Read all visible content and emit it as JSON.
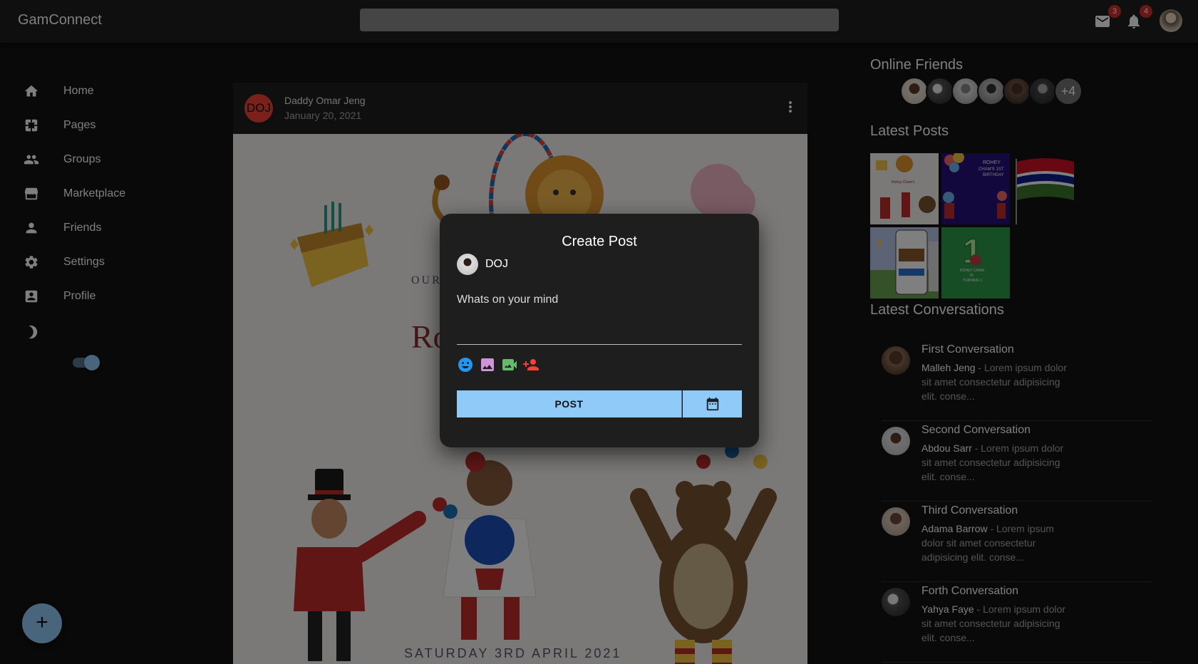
{
  "app": {
    "title": "GamConnect",
    "search_placeholder": ""
  },
  "topbar": {
    "mail_icon": "mail-icon",
    "mail_badge": "3",
    "bell_icon": "notifications-icon",
    "bell_badge": "4"
  },
  "sidebar": {
    "items": [
      {
        "label": "Home",
        "icon": "home-icon"
      },
      {
        "label": "Pages",
        "icon": "pages-icon"
      },
      {
        "label": "Groups",
        "icon": "groups-icon"
      },
      {
        "label": "Marketplace",
        "icon": "storefront-icon"
      },
      {
        "label": "Friends",
        "icon": "person-icon"
      },
      {
        "label": "Settings",
        "icon": "gear-icon"
      },
      {
        "label": "Profile",
        "icon": "account-box-icon"
      }
    ],
    "dark_mode_icon": "moon-icon",
    "dark_mode_on": true,
    "fab_label": "+"
  },
  "post": {
    "avatar_text": "DOJ",
    "author": "Daddy Omar Jeng",
    "date": "January 20, 2021",
    "image_text_top": "OUR",
    "image_text_name": "Ro",
    "image_text_bottom": "SATURDAY 3RD APRIL 2021"
  },
  "right": {
    "online_friends_title": "Online Friends",
    "online_more": "+4",
    "latest_posts_title": "Latest Posts",
    "latest_posts_thumbs": [
      "ROHEY CHAM'S 1ST BIRTHDAY"
    ],
    "latest_conversations_title": "Latest Conversations",
    "conversations": [
      {
        "title": "First Conversation",
        "name": "Malleh Jeng",
        "text": " - Lorem ipsum dolor sit amet consectetur adipisicing elit. conse..."
      },
      {
        "title": "Second Conversation",
        "name": "Abdou Sarr",
        "text": " - Lorem ipsum dolor sit amet consectetur adipisicing elit. conse..."
      },
      {
        "title": "Third Conversation",
        "name": "Adama Barrow",
        "text": " - Lorem ipsum dolor sit amet consectetur adipisicing elit. conse..."
      },
      {
        "title": "Forth Conversation",
        "name": "Yahya Faye",
        "text": " - Lorem ipsum dolor sit amet consectetur adipisicing elit. conse..."
      }
    ]
  },
  "modal": {
    "title": "Create Post",
    "user": "DOJ",
    "placeholder": "Whats on your mind",
    "post_button": "POST",
    "icons": [
      "emoji-icon",
      "image-icon",
      "video-icon",
      "tag-person-icon",
      "calendar-icon"
    ],
    "colors": {
      "emoji": "#2196f3",
      "image": "#ce93d8",
      "video": "#66bb6a",
      "tag": "#f44336",
      "button": "#90caf9"
    }
  }
}
